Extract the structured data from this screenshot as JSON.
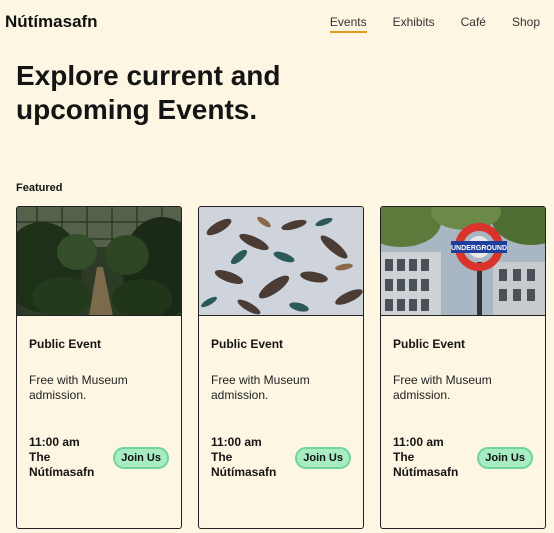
{
  "brand": "Nútímasafn",
  "nav": [
    {
      "label": "Events",
      "active": true
    },
    {
      "label": "Exhibits",
      "active": false
    },
    {
      "label": "Café",
      "active": false
    },
    {
      "label": "Shop",
      "active": false
    }
  ],
  "hero": {
    "title": "Explore current and upcoming Events."
  },
  "featured_label": "Featured",
  "cards": [
    {
      "image": "greenhouse-path",
      "title": "Public Event",
      "description": "Free with Museum admission.",
      "time": "11:00 am",
      "venue": "The Nútímasafn",
      "button": "Join Us"
    },
    {
      "image": "hummingbird-sculpture",
      "title": "Public Event",
      "description": "Free with Museum admission.",
      "time": "11:00 am",
      "venue": "The Nútímasafn",
      "button": "Join Us"
    },
    {
      "image": "underground-sign",
      "title": "Public Event",
      "description": "Free with Museum admission.",
      "time": "11:00 am",
      "venue": "The Nútímasafn",
      "button": "Join Us",
      "sign_text": "UNDERGROUND"
    }
  ],
  "colors": {
    "background": "#fcf6e3",
    "accent": "#e59a1d",
    "button": "#a7ecc2"
  }
}
